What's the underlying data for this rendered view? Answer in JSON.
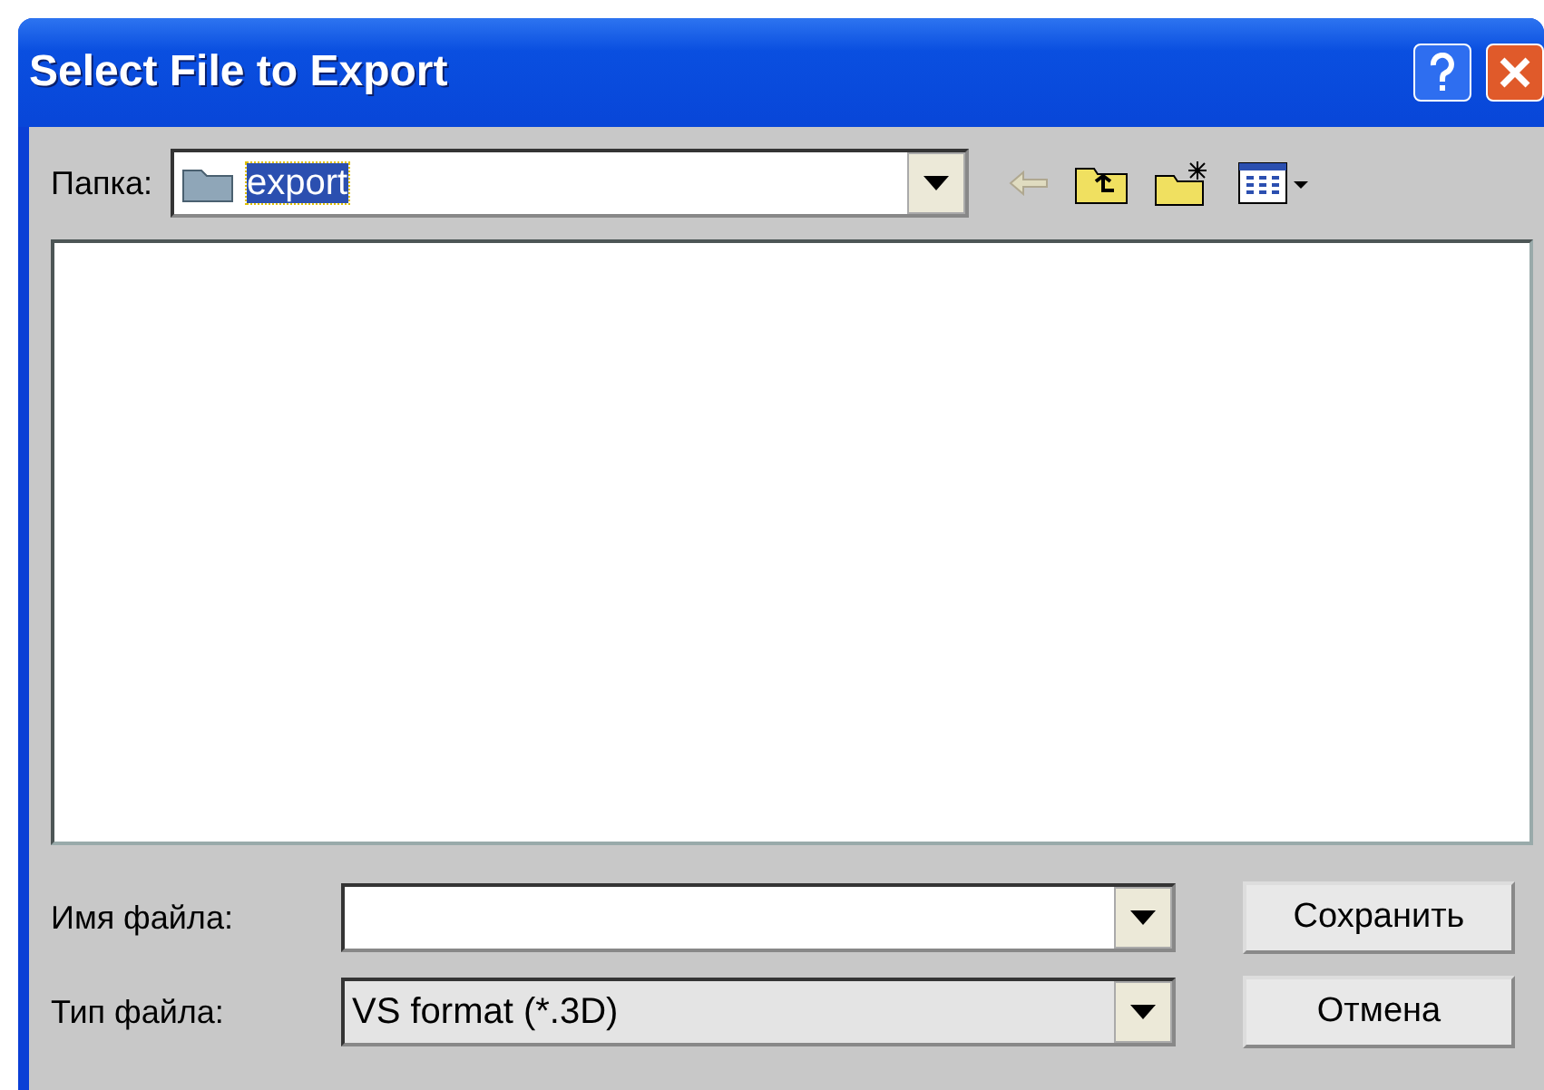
{
  "window": {
    "title": "Select File to Export"
  },
  "folder": {
    "label": "Папка:",
    "value": "export"
  },
  "file_name": {
    "label": "Имя файла:"
  },
  "file_type": {
    "label": "Тип файла:",
    "value": "VS format (*.3D)"
  },
  "buttons": [
    "Сохранить",
    "Отмена"
  ]
}
